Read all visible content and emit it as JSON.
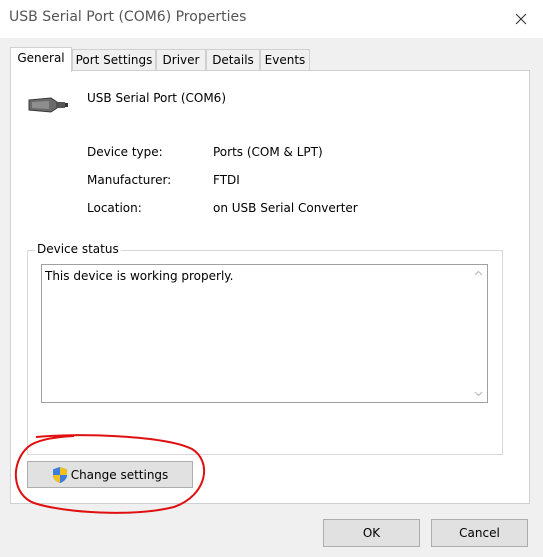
{
  "window": {
    "title": "USB Serial Port (COM6) Properties"
  },
  "tabs": [
    "General",
    "Port Settings",
    "Driver",
    "Details",
    "Events"
  ],
  "general": {
    "device_name": "USB Serial Port (COM6)",
    "properties": [
      {
        "label": "Device type:",
        "value": "Ports (COM & LPT)"
      },
      {
        "label": "Manufacturer:",
        "value": "FTDI"
      },
      {
        "label": "Location:",
        "value": "on USB Serial Converter"
      }
    ],
    "device_status": {
      "group_label": "Device status",
      "text": "This device is working properly."
    },
    "change_settings_label": "Change settings"
  },
  "buttons": {
    "ok": "OK",
    "cancel": "Cancel"
  },
  "colors": {
    "annotation_circle": "#e01010"
  }
}
